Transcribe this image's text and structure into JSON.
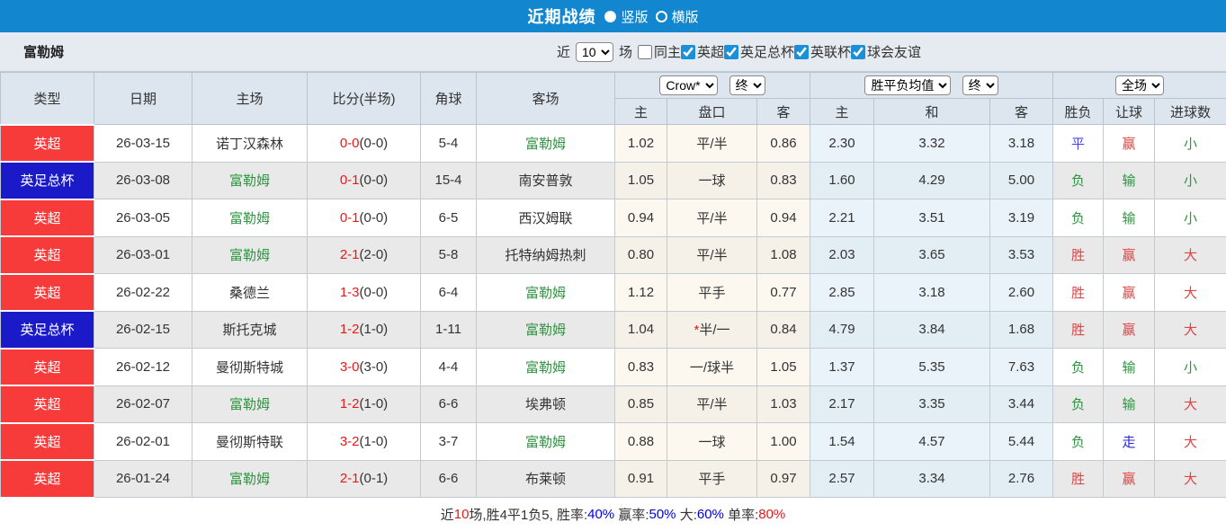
{
  "colors": {
    "topbar": "#1287d0",
    "type_red": "#f73b3b",
    "type_blue": "#1a1ac8",
    "green": "#2e9440",
    "red": "#e61919",
    "soft_red": "#dd4444",
    "blue": "#4646e8",
    "walk_blue": "#2828cc",
    "footer_blue": "#0000e0",
    "dark": "#333333"
  },
  "title_bar": {
    "title": "近期战绩",
    "radios": [
      {
        "label": "竖版",
        "selected": true
      },
      {
        "label": "横版",
        "selected": false
      }
    ]
  },
  "filter_bar": {
    "team": "富勒姆",
    "near_label": "近",
    "near_value": "10",
    "matches_label": "场",
    "checkboxes": [
      {
        "label": "同主",
        "checked": false
      },
      {
        "label": "英超",
        "checked": true
      },
      {
        "label": "英足总杯",
        "checked": true
      },
      {
        "label": "英联杯",
        "checked": true
      },
      {
        "label": "球会友谊",
        "checked": true
      }
    ]
  },
  "table": {
    "static_headers": [
      "类型",
      "日期",
      "主场",
      "比分(半场)",
      "角球",
      "客场"
    ],
    "selects": {
      "company": "Crow*",
      "company_time": "终",
      "avg": "胜平负均值",
      "avg_time": "终",
      "scope": "全场"
    },
    "sub_headers": [
      "主",
      "盘口",
      "客",
      "主",
      "和",
      "客",
      "胜负",
      "让球",
      "进球数"
    ],
    "rows": [
      {
        "type": {
          "text": "英超",
          "color": "red"
        },
        "date": "26-03-15",
        "home": {
          "text": "诺丁汉森林",
          "color": "dark"
        },
        "score": {
          "full": "0-0",
          "half": "(0-0)"
        },
        "corner": "5-4",
        "away": {
          "text": "富勒姆",
          "color": "green"
        },
        "odds_home": "1.02",
        "handicap": {
          "text": "平/半",
          "star": false
        },
        "odds_away": "0.86",
        "avg_home": "2.30",
        "avg_draw": "3.32",
        "avg_away": "3.18",
        "result": {
          "text": "平",
          "color": "blue"
        },
        "let_result": {
          "text": "赢",
          "color": "soft_red"
        },
        "goals": {
          "text": "小",
          "color": "green"
        }
      },
      {
        "type": {
          "text": "英足总杯",
          "color": "blue"
        },
        "date": "26-03-08",
        "home": {
          "text": "富勒姆",
          "color": "green"
        },
        "score": {
          "full": "0-1",
          "half": "(0-0)"
        },
        "corner": "15-4",
        "away": {
          "text": "南安普敦",
          "color": "dark"
        },
        "odds_home": "1.05",
        "handicap": {
          "text": "一球",
          "star": false
        },
        "odds_away": "0.83",
        "avg_home": "1.60",
        "avg_draw": "4.29",
        "avg_away": "5.00",
        "result": {
          "text": "负",
          "color": "green"
        },
        "let_result": {
          "text": "输",
          "color": "green"
        },
        "goals": {
          "text": "小",
          "color": "green"
        }
      },
      {
        "type": {
          "text": "英超",
          "color": "red"
        },
        "date": "26-03-05",
        "home": {
          "text": "富勒姆",
          "color": "green"
        },
        "score": {
          "full": "0-1",
          "half": "(0-0)"
        },
        "corner": "6-5",
        "away": {
          "text": "西汉姆联",
          "color": "dark"
        },
        "odds_home": "0.94",
        "handicap": {
          "text": "平/半",
          "star": false
        },
        "odds_away": "0.94",
        "avg_home": "2.21",
        "avg_draw": "3.51",
        "avg_away": "3.19",
        "result": {
          "text": "负",
          "color": "green"
        },
        "let_result": {
          "text": "输",
          "color": "green"
        },
        "goals": {
          "text": "小",
          "color": "green"
        }
      },
      {
        "type": {
          "text": "英超",
          "color": "red"
        },
        "date": "26-03-01",
        "home": {
          "text": "富勒姆",
          "color": "green"
        },
        "score": {
          "full": "2-1",
          "half": "(2-0)"
        },
        "corner": "5-8",
        "away": {
          "text": "托特纳姆热刺",
          "color": "dark"
        },
        "odds_home": "0.80",
        "handicap": {
          "text": "平/半",
          "star": false
        },
        "odds_away": "1.08",
        "avg_home": "2.03",
        "avg_draw": "3.65",
        "avg_away": "3.53",
        "result": {
          "text": "胜",
          "color": "soft_red"
        },
        "let_result": {
          "text": "赢",
          "color": "soft_red"
        },
        "goals": {
          "text": "大",
          "color": "soft_red"
        }
      },
      {
        "type": {
          "text": "英超",
          "color": "red"
        },
        "date": "26-02-22",
        "home": {
          "text": "桑德兰",
          "color": "dark"
        },
        "score": {
          "full": "1-3",
          "half": "(0-0)"
        },
        "corner": "6-4",
        "away": {
          "text": "富勒姆",
          "color": "green"
        },
        "odds_home": "1.12",
        "handicap": {
          "text": "平手",
          "star": false
        },
        "odds_away": "0.77",
        "avg_home": "2.85",
        "avg_draw": "3.18",
        "avg_away": "2.60",
        "result": {
          "text": "胜",
          "color": "soft_red"
        },
        "let_result": {
          "text": "赢",
          "color": "soft_red"
        },
        "goals": {
          "text": "大",
          "color": "soft_red"
        }
      },
      {
        "type": {
          "text": "英足总杯",
          "color": "blue"
        },
        "date": "26-02-15",
        "home": {
          "text": "斯托克城",
          "color": "dark"
        },
        "score": {
          "full": "1-2",
          "half": "(1-0)"
        },
        "corner": "1-11",
        "away": {
          "text": "富勒姆",
          "color": "green"
        },
        "odds_home": "1.04",
        "handicap": {
          "text": "半/一",
          "star": true
        },
        "odds_away": "0.84",
        "avg_home": "4.79",
        "avg_draw": "3.84",
        "avg_away": "1.68",
        "result": {
          "text": "胜",
          "color": "soft_red"
        },
        "let_result": {
          "text": "赢",
          "color": "soft_red"
        },
        "goals": {
          "text": "大",
          "color": "soft_red"
        }
      },
      {
        "type": {
          "text": "英超",
          "color": "red"
        },
        "date": "26-02-12",
        "home": {
          "text": "曼彻斯特城",
          "color": "dark"
        },
        "score": {
          "full": "3-0",
          "half": "(3-0)"
        },
        "corner": "4-4",
        "away": {
          "text": "富勒姆",
          "color": "green"
        },
        "odds_home": "0.83",
        "handicap": {
          "text": "一/球半",
          "star": false
        },
        "odds_away": "1.05",
        "avg_home": "1.37",
        "avg_draw": "5.35",
        "avg_away": "7.63",
        "result": {
          "text": "负",
          "color": "green"
        },
        "let_result": {
          "text": "输",
          "color": "green"
        },
        "goals": {
          "text": "小",
          "color": "green"
        }
      },
      {
        "type": {
          "text": "英超",
          "color": "red"
        },
        "date": "26-02-07",
        "home": {
          "text": "富勒姆",
          "color": "green"
        },
        "score": {
          "full": "1-2",
          "half": "(1-0)"
        },
        "corner": "6-6",
        "away": {
          "text": "埃弗顿",
          "color": "dark"
        },
        "odds_home": "0.85",
        "handicap": {
          "text": "平/半",
          "star": false
        },
        "odds_away": "1.03",
        "avg_home": "2.17",
        "avg_draw": "3.35",
        "avg_away": "3.44",
        "result": {
          "text": "负",
          "color": "green"
        },
        "let_result": {
          "text": "输",
          "color": "green"
        },
        "goals": {
          "text": "大",
          "color": "soft_red"
        }
      },
      {
        "type": {
          "text": "英超",
          "color": "red"
        },
        "date": "26-02-01",
        "home": {
          "text": "曼彻斯特联",
          "color": "dark"
        },
        "score": {
          "full": "3-2",
          "half": "(1-0)"
        },
        "corner": "3-7",
        "away": {
          "text": "富勒姆",
          "color": "green"
        },
        "odds_home": "0.88",
        "handicap": {
          "text": "一球",
          "star": false
        },
        "odds_away": "1.00",
        "avg_home": "1.54",
        "avg_draw": "4.57",
        "avg_away": "5.44",
        "result": {
          "text": "负",
          "color": "green"
        },
        "let_result": {
          "text": "走",
          "color": "walk_blue"
        },
        "goals": {
          "text": "大",
          "color": "soft_red"
        }
      },
      {
        "type": {
          "text": "英超",
          "color": "red"
        },
        "date": "26-01-24",
        "home": {
          "text": "富勒姆",
          "color": "green"
        },
        "score": {
          "full": "2-1",
          "half": "(0-1)"
        },
        "corner": "6-6",
        "away": {
          "text": "布莱顿",
          "color": "dark"
        },
        "odds_home": "0.91",
        "handicap": {
          "text": "平手",
          "star": false
        },
        "odds_away": "0.97",
        "avg_home": "2.57",
        "avg_draw": "3.34",
        "avg_away": "2.76",
        "result": {
          "text": "胜",
          "color": "soft_red"
        },
        "let_result": {
          "text": "赢",
          "color": "soft_red"
        },
        "goals": {
          "text": "大",
          "color": "soft_red"
        }
      }
    ]
  },
  "footer": {
    "segments": [
      {
        "text": "近",
        "color": "dark"
      },
      {
        "text": "10",
        "color": "red"
      },
      {
        "text": "场,胜4平1负5, 胜率:",
        "color": "dark"
      },
      {
        "text": "40%",
        "color": "footer_blue"
      },
      {
        "text": " 赢率:",
        "color": "dark"
      },
      {
        "text": "50%",
        "color": "footer_blue"
      },
      {
        "text": " 大:",
        "color": "dark"
      },
      {
        "text": "60%",
        "color": "footer_blue"
      },
      {
        "text": " 单率:",
        "color": "dark"
      },
      {
        "text": "80%",
        "color": "red"
      }
    ]
  }
}
